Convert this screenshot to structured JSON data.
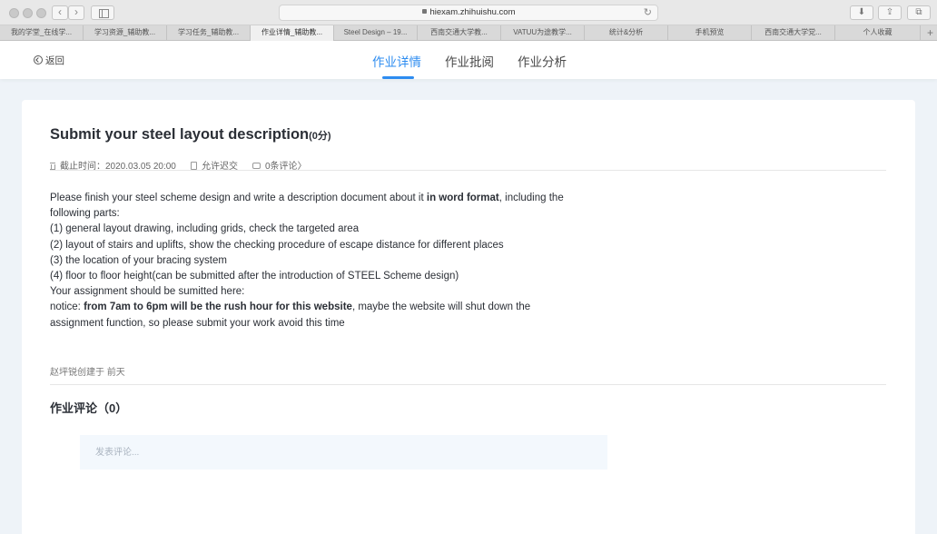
{
  "browser": {
    "url": "hiexam.zhihuishu.com",
    "tabs": [
      {
        "label": "我的学堂_在线学..."
      },
      {
        "label": "学习资源_辅助教..."
      },
      {
        "label": "学习任务_辅助教..."
      },
      {
        "label": "作业详情_辅助教..."
      },
      {
        "label": "Steel Design – 19..."
      },
      {
        "label": "西南交通大学教..."
      },
      {
        "label": "VATUU为途教学..."
      },
      {
        "label": "统计&分析"
      },
      {
        "label": "手机预览"
      },
      {
        "label": "西南交通大学党..."
      },
      {
        "label": "个人收藏"
      }
    ],
    "active_tab_index": 3,
    "new_tab_label": "+"
  },
  "header": {
    "back_label": "返回",
    "nav_tabs": [
      {
        "label": "作业详情",
        "active": true
      },
      {
        "label": "作业批阅",
        "active": false
      },
      {
        "label": "作业分析",
        "active": false
      }
    ],
    "accent_color": "#2d8cf0"
  },
  "assignment": {
    "title": "Submit your steel layout description",
    "score": "(0分)",
    "deadline_label": "截止时间：",
    "deadline_value": "2020.03.05 20:00",
    "late_submission": "允许迟交",
    "comment_count_link": "0条评论",
    "chevron": "〉",
    "description": {
      "line1_pre": "Please finish your steel scheme design and write a description document about it ",
      "line1_bold": "in word format",
      "line1_post": ", including the",
      "line2": "following parts:",
      "line3": "(1) general layout drawing, including grids, check the targeted area",
      "line4": "(2) layout of stairs and uplifts, show the checking procedure of escape distance for different places",
      "line5": "(3) the location of your bracing system",
      "line6": "(4) floor to floor height(can be submitted after the introduction of STEEL Scheme design)",
      "line7": "Your assignment should be sumitted here:",
      "line8_pre": "notice: ",
      "line8_bold": "from 7am to 6pm will be the rush hour for this website",
      "line8_post": ", maybe the website will shut down the",
      "line9": "assignment function, so please submit your work avoid this time"
    },
    "creator": "赵坪锐创建于 前天"
  },
  "comments": {
    "title": "作业评论（0）",
    "placeholder": "发表评论..."
  }
}
